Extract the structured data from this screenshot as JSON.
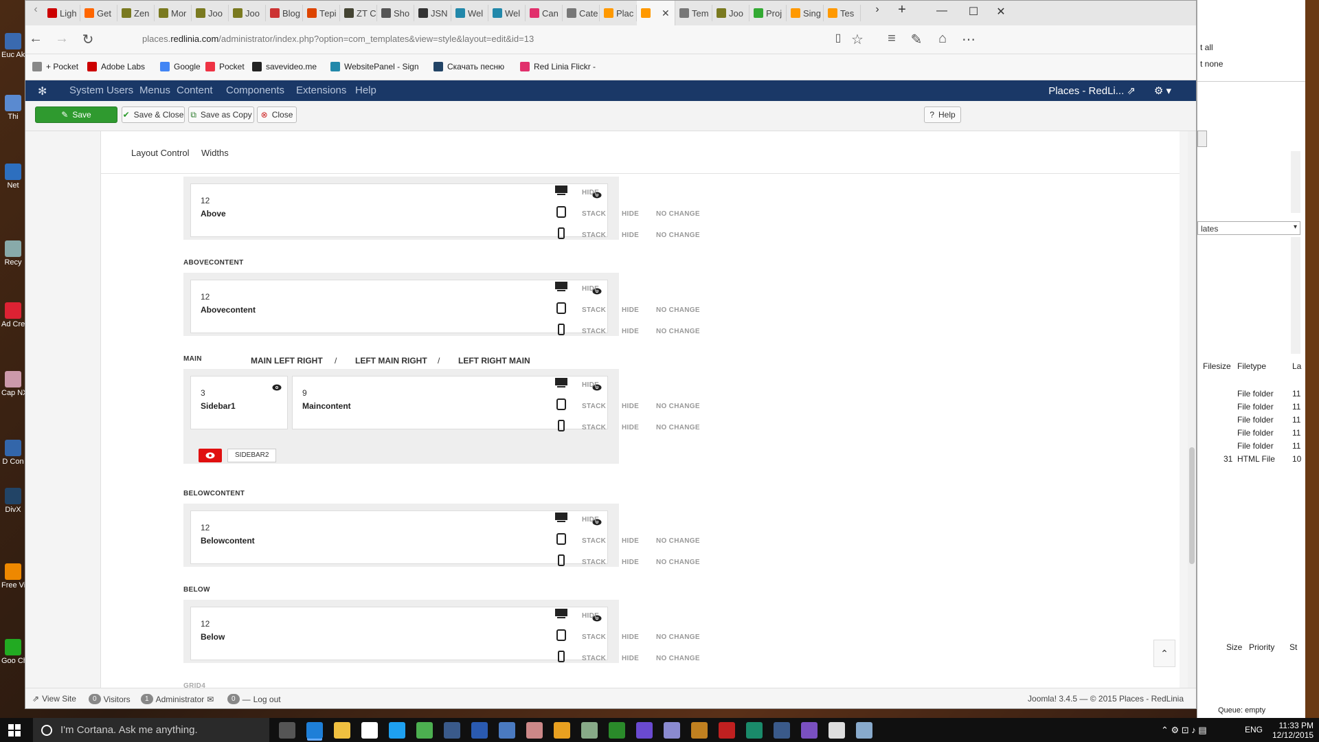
{
  "desktop": {
    "icons": [
      {
        "label": "Euc Aki",
        "color": "#3a6ab0"
      },
      {
        "label": "Thi",
        "color": "#5a8ad0"
      },
      {
        "label": "Net",
        "color": "#2d6fbf"
      },
      {
        "label": "Recy",
        "color": "#8aa"
      },
      {
        "label": "Ad Cre",
        "color": "#d23"
      },
      {
        "label": "Cap NX",
        "color": "#c9a"
      },
      {
        "label": "D Con",
        "color": "#36a"
      },
      {
        "label": "DivX",
        "color": "#246"
      },
      {
        "label": "Free Vide",
        "color": "#e80"
      },
      {
        "label": "Goo Chr",
        "color": "#2a2"
      }
    ]
  },
  "browser": {
    "tabs": [
      {
        "label": "Ligh",
        "color": "#c00"
      },
      {
        "label": "Get",
        "color": "#f60"
      },
      {
        "label": "Zen",
        "color": "#7a7a20"
      },
      {
        "label": "Mor",
        "color": "#7a7a20"
      },
      {
        "label": "Joo",
        "color": "#7a7a20"
      },
      {
        "label": "Joo",
        "color": "#7a7a20"
      },
      {
        "label": "Blog",
        "color": "#c33"
      },
      {
        "label": "Тері",
        "color": "#d40"
      },
      {
        "label": "ZT C",
        "color": "#443"
      },
      {
        "label": "Sho",
        "color": "#555"
      },
      {
        "label": "JSN",
        "color": "#333"
      },
      {
        "label": "Wel",
        "color": "#28a"
      },
      {
        "label": "Wel",
        "color": "#28a"
      },
      {
        "label": "Can",
        "color": "#e1306c"
      },
      {
        "label": "Cate",
        "color": "#777"
      },
      {
        "label": "Plac",
        "color": "#f90"
      },
      {
        "label": "",
        "color": "#f90"
      },
      {
        "label": "Tem",
        "color": "#777"
      },
      {
        "label": "Joo",
        "color": "#7a7a20"
      },
      {
        "label": "Proj",
        "color": "#3a3"
      },
      {
        "label": "Sing",
        "color": "#f90"
      },
      {
        "label": "Tes",
        "color": "#f90"
      }
    ],
    "url_prefix": "places.",
    "url_domain": "redlinia.com",
    "url_path": "/administrator/index.php?option=com_templates&view=style&layout=edit&id=13",
    "favorites": [
      {
        "label": "+ Pocket",
        "color": "#888"
      },
      {
        "label": "Adobe Labs",
        "color": "#c00"
      },
      {
        "label": "Google",
        "color": "#4285f4"
      },
      {
        "label": "Pocket",
        "color": "#e34"
      },
      {
        "label": "savevideo.me",
        "color": "#222"
      },
      {
        "label": "WebsitePanel - Sign",
        "color": "#28a"
      },
      {
        "label": "Скачать песню",
        "color": "#246"
      },
      {
        "label": "Red Linia  Flickr -",
        "color": "#e1306c"
      }
    ]
  },
  "joomla": {
    "menu": [
      "System",
      "Users",
      "Menus",
      "Content",
      "Components",
      "Extensions",
      "Help"
    ],
    "site_title": "Places - RedLi...",
    "toolbar": {
      "save": "Save",
      "save_close": "Save & Close",
      "save_copy": "Save as Copy",
      "close": "Close",
      "help": "Help"
    },
    "tabs": [
      "Layout Control",
      "Widths"
    ],
    "sections": [
      {
        "label": "",
        "cards": [
          {
            "num": "12",
            "name": "Above"
          }
        ]
      },
      {
        "label": "ABOVECONTENT",
        "cards": [
          {
            "num": "12",
            "name": "Abovecontent"
          }
        ]
      },
      {
        "label": "MAIN",
        "cards": [
          {
            "num": "3",
            "name": "Sidebar1"
          },
          {
            "num": "9",
            "name": "Maincontent"
          }
        ],
        "hidden_chip": "SIDEBAR2"
      },
      {
        "label": "BELOWCONTENT",
        "cards": [
          {
            "num": "12",
            "name": "Belowcontent"
          }
        ]
      },
      {
        "label": "BELOW",
        "cards": [
          {
            "num": "12",
            "name": "Below"
          }
        ]
      },
      {
        "label": "GRID4",
        "cards": []
      }
    ],
    "main_layouts": [
      "MAIN LEFT RIGHT",
      "/",
      "LEFT MAIN RIGHT",
      "/",
      "LEFT RIGHT MAIN"
    ],
    "device_options": {
      "hide": "HIDE",
      "stack": "STACK",
      "no_change": "NO CHANGE"
    },
    "status": {
      "view_site": "View Site",
      "visitors_count": "0",
      "visitors": "Visitors",
      "admin_count": "1",
      "admin": "Administrator",
      "msg_count": "0",
      "logout": "Log out",
      "footer": "Joomla! 3.4.5  —  © 2015 Places - RedLinia"
    }
  },
  "right_window": {
    "top_items": [
      "t all",
      "t none"
    ],
    "dropdown": "lates",
    "headers": [
      "Filesize",
      "Filetype",
      "La"
    ],
    "rows": [
      {
        "size": "",
        "type": "File folder",
        "last": "11"
      },
      {
        "size": "",
        "type": "File folder",
        "last": "11"
      },
      {
        "size": "",
        "type": "File folder",
        "last": "11"
      },
      {
        "size": "",
        "type": "File folder",
        "last": "11"
      },
      {
        "size": "",
        "type": "File folder",
        "last": "11"
      },
      {
        "size": "31",
        "type": "HTML File",
        "last": "10"
      }
    ],
    "queue_headers": [
      "Size",
      "Priority",
      "St"
    ],
    "queue": "Queue: empty"
  },
  "taskbar": {
    "cortana": "I'm Cortana. Ask me anything.",
    "lang": "ENG",
    "time": "11:33 PM",
    "date": "12/12/2015"
  }
}
